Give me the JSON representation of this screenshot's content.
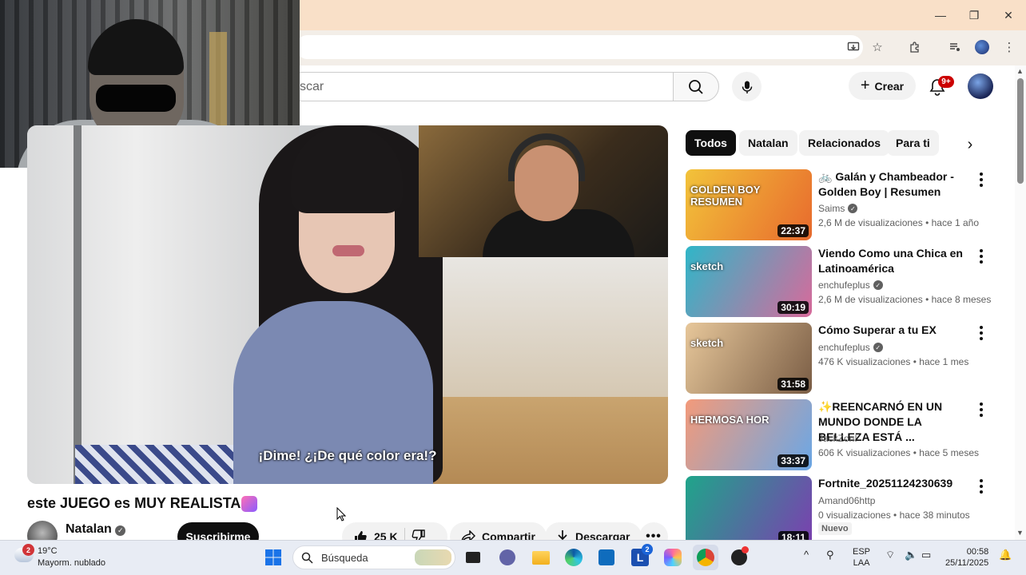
{
  "browser": {
    "window_controls": {
      "minimize": "—",
      "maximize": "❐",
      "close": "✕"
    }
  },
  "youtube": {
    "search_placeholder": "scar",
    "create_label": "Crear",
    "notifications_badge": "9+"
  },
  "video": {
    "subtitle": "¡Dime! ¿¡De qué color era!?",
    "title": "este JUEGO es MUY REALISTA",
    "channel_name": "Natalan",
    "subscribe_label": "Suscribirme",
    "likes": "25 K",
    "share_label": "Compartir",
    "download_label": "Descargar"
  },
  "chips": [
    "Todos",
    "Natalan",
    "Relacionados",
    "Para ti"
  ],
  "recommendations": [
    {
      "title": "🚲 Galán y Chambeador - Golden Boy | Resumen",
      "channel": "Saims",
      "verified": true,
      "views": "2,6 M de visualizaciones",
      "age": "hace 1 año",
      "duration": "22:37",
      "thumb_text": "GOLDEN BOY RESUMEN",
      "thumb_colors": [
        "#f2c33a",
        "#e86a2d"
      ]
    },
    {
      "title": "Viendo Como una Chica en Latinoamérica",
      "channel": "enchufeplus",
      "verified": true,
      "views": "2,6 M de visualizaciones",
      "age": "hace 8 meses",
      "duration": "30:19",
      "thumb_text": "sketch",
      "thumb_colors": [
        "#2fb6c8",
        "#d86a9b"
      ]
    },
    {
      "title": "Cómo Superar a tu EX",
      "channel": "enchufeplus",
      "verified": true,
      "views": "476 K visualizaciones",
      "age": "hace 1 mes",
      "duration": "31:58",
      "thumb_text": "sketch",
      "thumb_colors": [
        "#e7c79a",
        "#7a5d45"
      ]
    },
    {
      "title": "✨REENCARNÓ EN UN MUNDO DONDE LA BELLEZA ESTÁ ...",
      "channel": "JackZon!",
      "verified": false,
      "views": "606 K visualizaciones",
      "age": "hace 5 meses",
      "duration": "33:37",
      "thumb_text": "HERMOSA HOR",
      "thumb_colors": [
        "#f39a7a",
        "#6aa7e6"
      ]
    },
    {
      "title": "Fortnite_20251124230639",
      "channel": "Amand06http",
      "verified": false,
      "views": "0 visualizaciones",
      "age": "hace 38 minutos",
      "duration": "18:11",
      "thumb_text": "",
      "thumb_colors": [
        "#1fa58a",
        "#7c3fb0"
      ],
      "badge": "Nuevo"
    }
  ],
  "taskbar": {
    "weather_badge": "2",
    "temperature": "19°C",
    "weather_desc": "Mayorm. nublado",
    "search_placeholder": "Búsqueda",
    "language_1": "ESP",
    "language_2": "LAA",
    "time": "00:58",
    "date": "25/11/2025",
    "outlook_badge": "2"
  }
}
